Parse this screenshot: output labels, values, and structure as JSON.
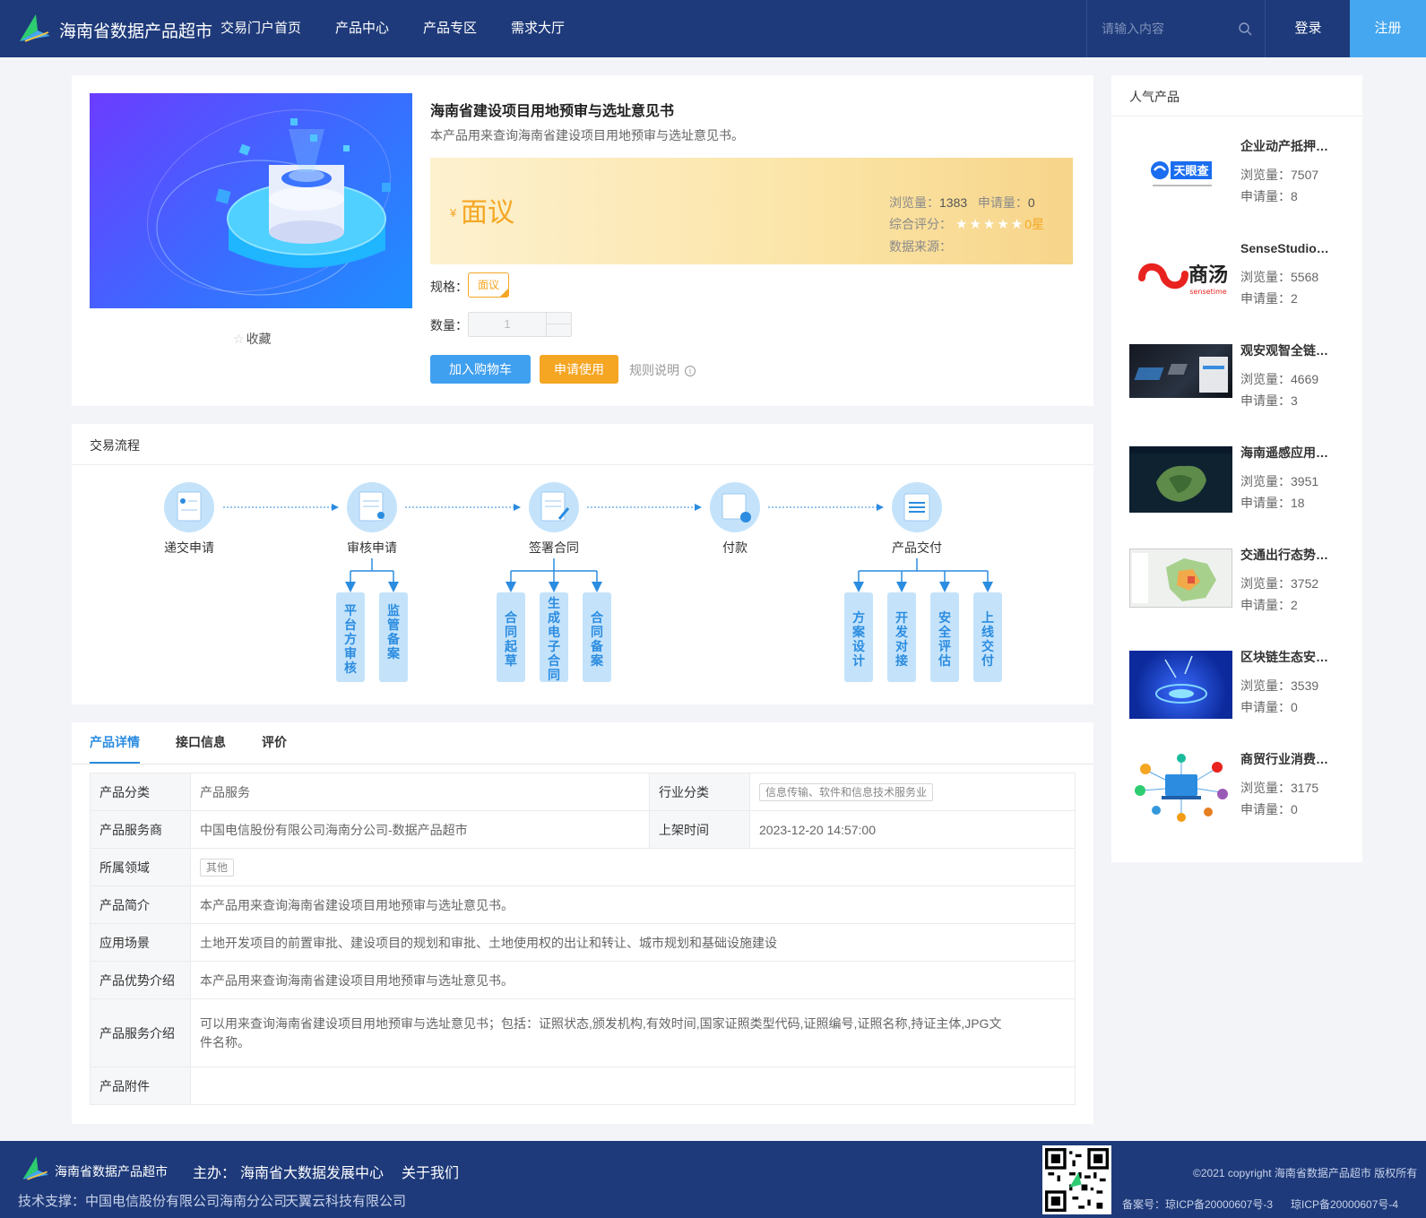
{
  "header": {
    "site_title": "海南省数据产品超市",
    "nav": [
      "交易门户首页",
      "产品中心",
      "产品专区",
      "需求大厅"
    ],
    "search_placeholder": "请输入内容",
    "login": "登录",
    "register": "注册"
  },
  "product": {
    "title": "海南省建设项目用地预审与选址意见书",
    "desc": "本产品用来查询海南省建设项目用地预审与选址意见书。",
    "currency_symbol": "¥",
    "price": "面议",
    "views_label": "浏览量：",
    "views": "1383",
    "applies_label": "申请量：",
    "applies": "0",
    "rating_label": "综合评分：",
    "rating_stars": "★★★★★",
    "rating_value": "0星",
    "source_label": "数据来源：",
    "spec_label": "规格：",
    "spec_value": "面议",
    "qty_label": "数量：",
    "qty_value": "1",
    "cart_button": "加入购物车",
    "apply_button": "申请使用",
    "rules": "规则说明",
    "favorite": "收藏"
  },
  "flow": {
    "title": "交易流程",
    "steps": [
      "递交申请",
      "审核申请",
      "签署合同",
      "付款",
      "产品交付"
    ],
    "sub_review": [
      "平台方审核",
      "监管备案"
    ],
    "sub_contract": [
      "合同起草",
      "生成电子合同",
      "合同备案"
    ],
    "sub_delivery": [
      "方案设计",
      "开发对接",
      "安全评估",
      "上线交付"
    ]
  },
  "tabs": [
    "产品详情",
    "接口信息",
    "评价"
  ],
  "details": {
    "category_k": "产品分类",
    "category_v": "产品服务",
    "industry_k": "行业分类",
    "industry_v": "信息传输、软件和信息技术服务业",
    "provider_k": "产品服务商",
    "provider_v": "中国电信股份有限公司海南分公司-数据产品超市",
    "online_k": "上架时间",
    "online_v": "2023-12-20 14:57:00",
    "domain_k": "所属领域",
    "domain_v": "其他",
    "intro_k": "产品简介",
    "intro_v": "本产品用来查询海南省建设项目用地预审与选址意见书。",
    "scene_k": "应用场景",
    "scene_v": "土地开发项目的前置审批、建设项目的规划和审批、土地使用权的出让和转让、城市规划和基础设施建设",
    "adv_k": "产品优势介绍",
    "adv_v": "本产品用来查询海南省建设项目用地预审与选址意见书。",
    "svc_k": "产品服务介绍",
    "svc_v": "可以用来查询海南省建设项目用地预审与选址意见书；包括：证照状态,颁发机构,有效时间,国家证照类型代码,证照编号,证照名称,持证主体,JPG文件名称。",
    "attach_k": "产品附件",
    "attach_v": ""
  },
  "sidebar": {
    "title": "人气产品",
    "items": [
      {
        "name": "企业动产抵押信息查询",
        "views": "浏览量：7507",
        "applies": "申请量：8"
      },
      {
        "name": "SenseStudio智能视觉平台",
        "views": "浏览量：5568",
        "applies": "申请量：2"
      },
      {
        "name": "观安观智全链路数据安全",
        "views": "浏览量：4669",
        "applies": "申请量：3"
      },
      {
        "name": "海南遥感应用服务平台",
        "views": "浏览量：3951",
        "applies": "申请量：18"
      },
      {
        "name": "交通出行态势分析",
        "views": "浏览量：3752",
        "applies": "申请量：2"
      },
      {
        "name": "区块链生态安全服务",
        "views": "浏览量：3539",
        "applies": "申请量：0"
      },
      {
        "name": "商贸行业消费分析",
        "views": "浏览量：3175",
        "applies": "申请量：0"
      }
    ],
    "thumb1_text": "天眼查",
    "thumb2_text": "商汤",
    "thumb2_sub": "sensetime"
  },
  "footer": {
    "name": "海南省数据产品超市",
    "host_label": "主办：",
    "host": "海南省大数据发展中心",
    "about": "关于我们",
    "support": "技术支撑：中国电信股份有限公司海南分公司",
    "support2": "天翼云科技有限公司",
    "copyright": "©2021 copyright 海南省数据产品超市 版权所有",
    "icp1": "备案号：琼ICP备20000607号-3",
    "icp2": "琼ICP备20000607号-4"
  },
  "colors": {
    "header_bg": "#1e3a7a",
    "accent_blue": "#40a0f0",
    "accent_orange": "#f5a623"
  }
}
